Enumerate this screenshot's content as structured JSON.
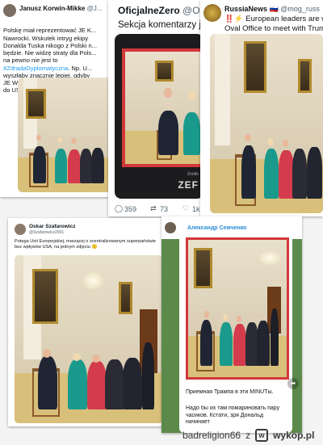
{
  "post1": {
    "author": "Janusz Korwin-Mikke",
    "handle": "@J...",
    "text": "Polskę miał reprezentować JE K...\nNawrocki. Wskutek intryg ekipy\nDonalda Tuska nikogo z Polski n...\nbędzie. Nie widzę straty dla Pols...\nna pewno nie jest to",
    "hashtag": "#ZdradaDyplomatyczna",
    "text2": ". Np. U...\nwyszłaby znacznie lepiej, gdyby\nJE Włodzimierz Zełeński nie pol...\ndo USA!"
  },
  "post2": {
    "author": "OficjalneZero",
    "handle": "@Of",
    "text": "Sekcja komentarzy jes",
    "tv_caption": "Źródło",
    "tv_logo": "ZEF",
    "replies": "359",
    "retweets": "73",
    "likes": "1k"
  },
  "post3": {
    "author": "RussiaNews",
    "flag": "🇷🇺",
    "handle": "@mog_russ",
    "text": "‼️⚡ European leaders are w\nOval Office to meet with Trum"
  },
  "post4": {
    "author": "Oskar Szafarowicz",
    "handle": "@Szafarowicz2001",
    "text": "Potęga Unii Europejskiej, marzącej o scentralizowanym superpaństwie bez wpływów USA, na jednym zdjęciu 🙂"
  },
  "post5": {
    "author": "Александр Семченко",
    "caption_title": "Приемная Трампа в эти MINUTы.",
    "caption_body": "Надо бы их там помариновать пару часиков. Кстати, зря Дональд начинает"
  },
  "footer": {
    "watermark_user": "badreligion66",
    "separator": "z",
    "brand": "wykop.pl"
  }
}
